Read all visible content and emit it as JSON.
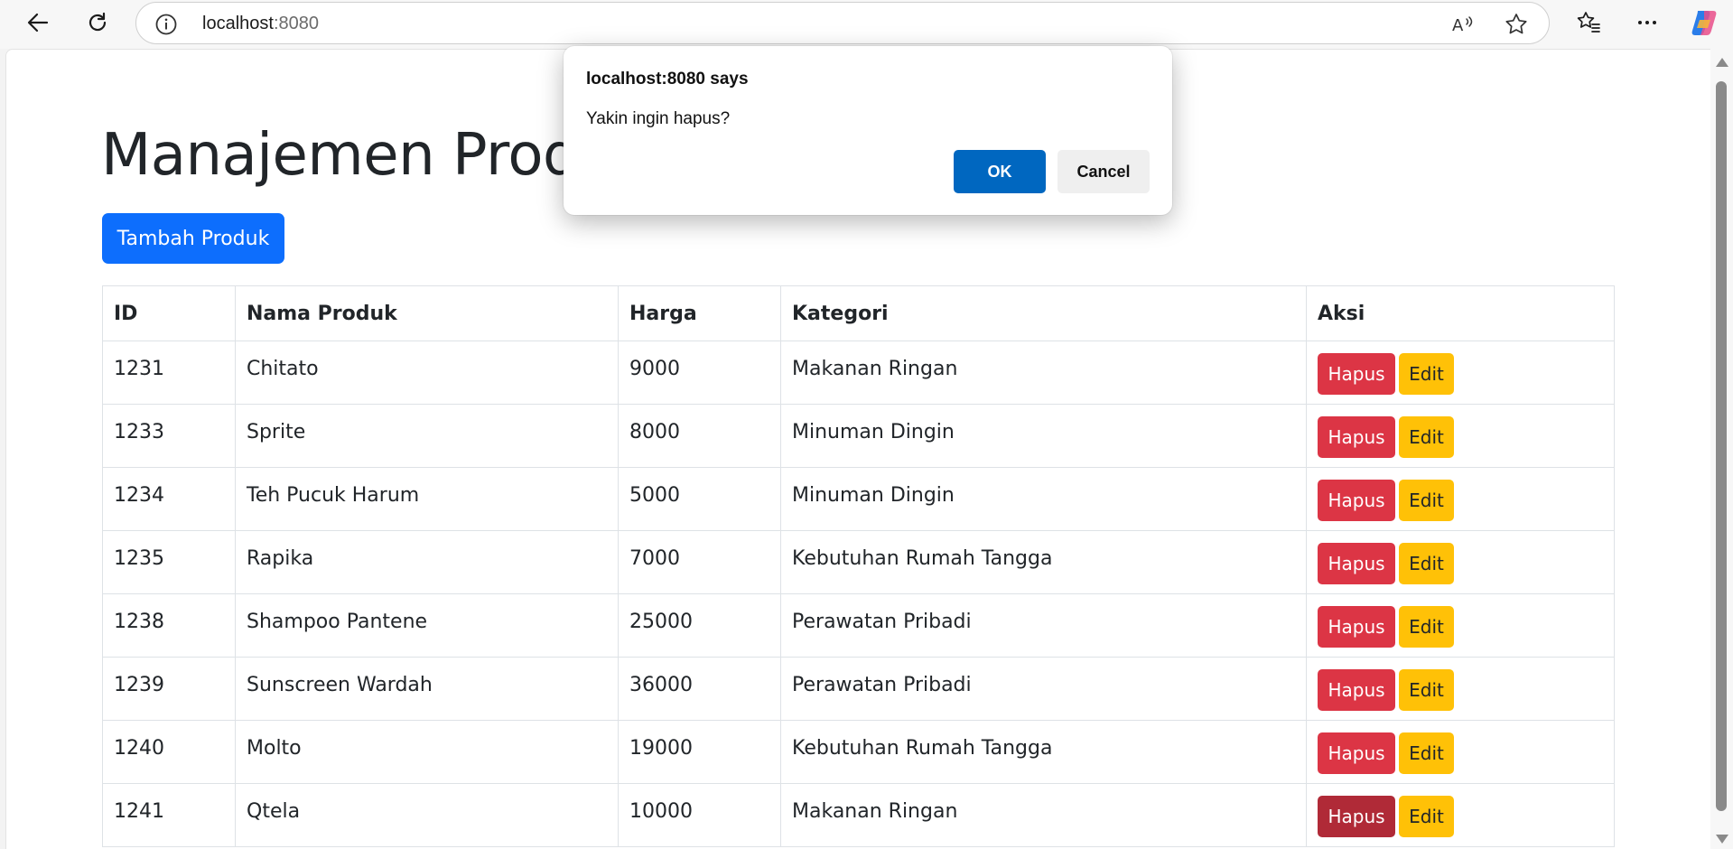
{
  "browser": {
    "url_host": "localhost",
    "url_port": ":8080"
  },
  "page": {
    "title": "Manajemen Produk",
    "add_button": "Tambah Produk",
    "table": {
      "headers": [
        "ID",
        "Nama Produk",
        "Harga",
        "Kategori",
        "Aksi"
      ],
      "rows": [
        {
          "id": "1231",
          "name": "Chitato",
          "price": "9000",
          "category": "Makanan Ringan"
        },
        {
          "id": "1233",
          "name": "Sprite",
          "price": "8000",
          "category": "Minuman Dingin"
        },
        {
          "id": "1234",
          "name": "Teh Pucuk Harum",
          "price": "5000",
          "category": "Minuman Dingin"
        },
        {
          "id": "1235",
          "name": "Rapika",
          "price": "7000",
          "category": "Kebutuhan Rumah Tangga"
        },
        {
          "id": "1238",
          "name": "Shampoo Pantene",
          "price": "25000",
          "category": "Perawatan Pribadi"
        },
        {
          "id": "1239",
          "name": "Sunscreen Wardah",
          "price": "36000",
          "category": "Perawatan Pribadi"
        },
        {
          "id": "1240",
          "name": "Molto",
          "price": "19000",
          "category": "Kebutuhan Rumah Tangga"
        },
        {
          "id": "1241",
          "name": "Qtela",
          "price": "10000",
          "category": "Makanan Ringan"
        }
      ],
      "delete_label": "Hapus",
      "edit_label": "Edit"
    }
  },
  "dialog": {
    "title": "localhost:8080 says",
    "message": "Yakin ingin hapus?",
    "ok_label": "OK",
    "cancel_label": "Cancel"
  },
  "colors": {
    "primary": "#0d6efd",
    "danger": "#dc3545",
    "danger_active": "#b02a37",
    "warning": "#ffc107",
    "dialog_ok": "#0067c0"
  },
  "icons": [
    "back-arrow-icon",
    "refresh-icon",
    "info-icon",
    "read-aloud-icon",
    "star-icon",
    "favorites-icon",
    "more-icon",
    "copilot-icon"
  ]
}
